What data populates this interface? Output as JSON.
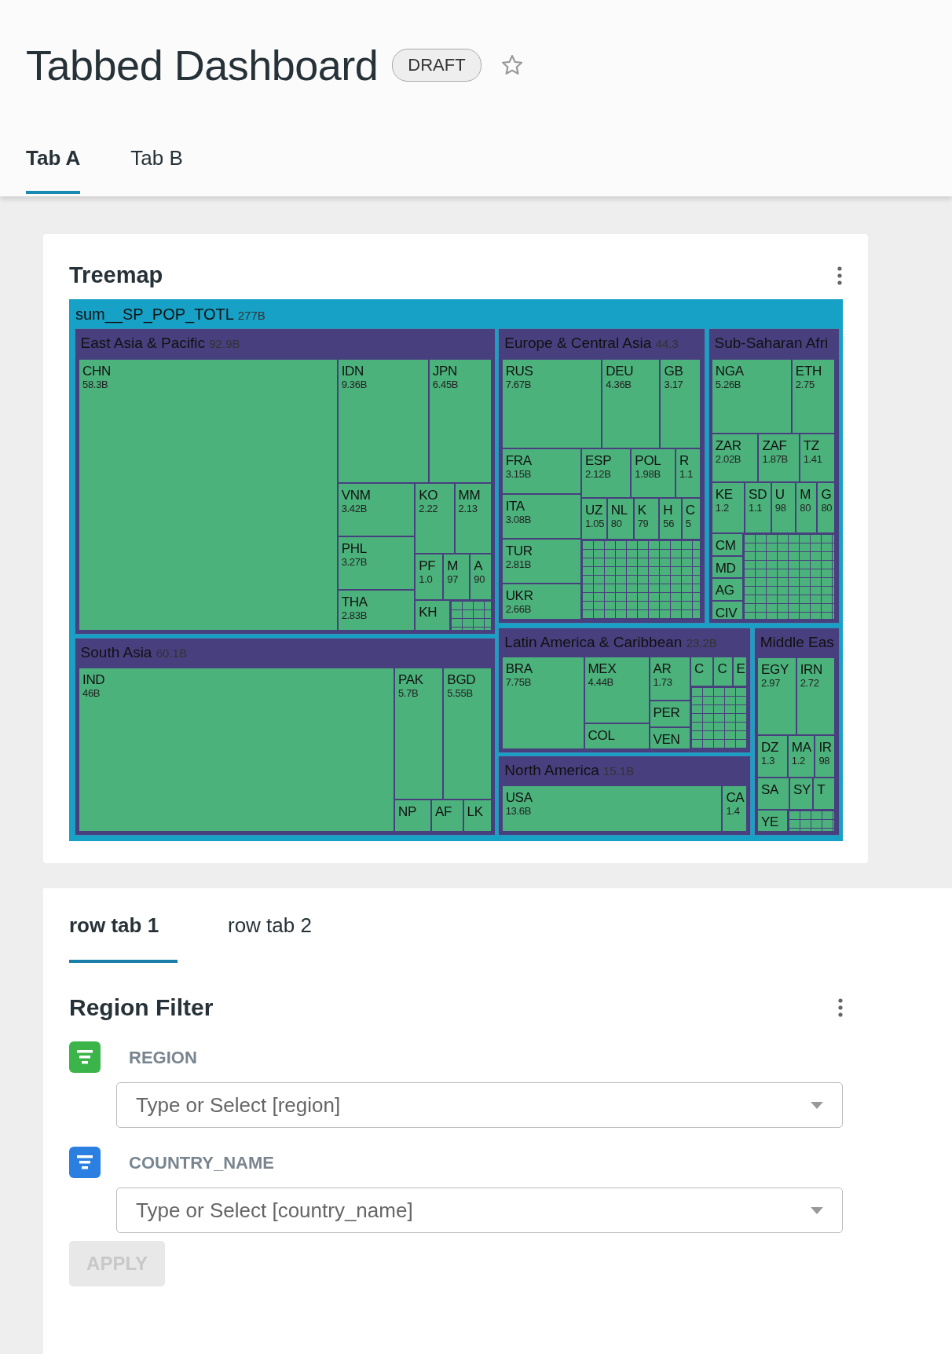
{
  "header": {
    "title": "Tabbed Dashboard",
    "badge": "DRAFT",
    "starred": false
  },
  "tabs": [
    {
      "label": "Tab A",
      "selected": true
    },
    {
      "label": "Tab B",
      "selected": false
    }
  ],
  "treemap_card": {
    "title": "Treemap",
    "root_label": "sum__SP_POP_TOTL",
    "root_value": "277B",
    "regions": [
      {
        "name": "East Asia & Pacific",
        "value": "92.9B",
        "countries": [
          {
            "code": "CHN",
            "value": "58.3B"
          },
          {
            "code": "IDN",
            "value": "9.36B"
          },
          {
            "code": "JPN",
            "value": "6.45B"
          },
          {
            "code": "VNM",
            "value": "3.42B"
          },
          {
            "code": "PHL",
            "value": "3.27B"
          },
          {
            "code": "THA",
            "value": "2.83B"
          },
          {
            "code": "KO",
            "value": "2.22"
          },
          {
            "code": "MM",
            "value": "2.13"
          },
          {
            "code": "PF",
            "value": "1.0"
          },
          {
            "code": "M",
            "value": "97"
          },
          {
            "code": "A",
            "value": "90"
          },
          {
            "code": "KH"
          }
        ]
      },
      {
        "name": "Europe & Central Asia",
        "value": "44.3",
        "countries": [
          {
            "code": "RUS",
            "value": "7.67B"
          },
          {
            "code": "DEU",
            "value": "4.36B"
          },
          {
            "code": "GB",
            "value": "3.17"
          },
          {
            "code": "FRA",
            "value": "3.15B"
          },
          {
            "code": "ITA",
            "value": "3.08B"
          },
          {
            "code": "TUR",
            "value": "2.81B"
          },
          {
            "code": "UKR",
            "value": "2.66B"
          },
          {
            "code": "ESP",
            "value": "2.12B"
          },
          {
            "code": "POL",
            "value": "1.98B"
          },
          {
            "code": "R",
            "value": "1.1"
          },
          {
            "code": "UZ",
            "value": "1.05"
          },
          {
            "code": "NL",
            "value": "80"
          },
          {
            "code": "K",
            "value": "79"
          },
          {
            "code": "H",
            "value": "56"
          },
          {
            "code": "C",
            "value": "5"
          }
        ]
      },
      {
        "name": "Sub-Saharan Afri",
        "countries": [
          {
            "code": "NGA",
            "value": "5.26B"
          },
          {
            "code": "ETH",
            "value": "2.75"
          },
          {
            "code": "ZAR",
            "value": "2.02B"
          },
          {
            "code": "ZAF",
            "value": "1.87B"
          },
          {
            "code": "TZ",
            "value": "1.41"
          },
          {
            "code": "KE",
            "value": "1.2"
          },
          {
            "code": "SD",
            "value": "1.1"
          },
          {
            "code": "U",
            "value": "98"
          },
          {
            "code": "M",
            "value": "80"
          },
          {
            "code": "G",
            "value": "80"
          },
          {
            "code": "CM"
          },
          {
            "code": "MD"
          },
          {
            "code": "AG"
          },
          {
            "code": "CIV"
          }
        ]
      },
      {
        "name": "South Asia",
        "value": "60.1B",
        "countries": [
          {
            "code": "IND",
            "value": "46B"
          },
          {
            "code": "PAK",
            "value": "5.7B"
          },
          {
            "code": "BGD",
            "value": "5.55B"
          },
          {
            "code": "NP"
          },
          {
            "code": "AF"
          },
          {
            "code": "LK"
          }
        ]
      },
      {
        "name": "Latin America & Caribbean",
        "value": "23.2B",
        "countries": [
          {
            "code": "BRA",
            "value": "7.75B"
          },
          {
            "code": "MEX",
            "value": "4.44B"
          },
          {
            "code": "COL"
          },
          {
            "code": "AR",
            "value": "1.73"
          },
          {
            "code": "PER"
          },
          {
            "code": "VEN"
          },
          {
            "code": "C"
          },
          {
            "code": "C"
          },
          {
            "code": "E"
          }
        ]
      },
      {
        "name": "Middle Eas",
        "countries": [
          {
            "code": "EGY",
            "value": "2.97"
          },
          {
            "code": "IRN",
            "value": "2.72"
          },
          {
            "code": "DZ",
            "value": "1.3"
          },
          {
            "code": "MA",
            "value": "1.2"
          },
          {
            "code": "IR",
            "value": "98"
          },
          {
            "code": "SA"
          },
          {
            "code": "SY"
          },
          {
            "code": "T"
          },
          {
            "code": "YE"
          }
        ]
      },
      {
        "name": "North America",
        "value": "15.1B",
        "countries": [
          {
            "code": "USA",
            "value": "13.6B"
          },
          {
            "code": "CA",
            "value": "1.4"
          }
        ]
      }
    ]
  },
  "row_tabs": [
    {
      "label": "row tab 1",
      "selected": true
    },
    {
      "label": "row tab 2",
      "selected": false
    }
  ],
  "filter_card": {
    "title": "Region Filter",
    "filters": [
      {
        "label": "REGION",
        "placeholder": "Type or Select [region]",
        "color": "#3bb44a"
      },
      {
        "label": "COUNTRY_NAME",
        "placeholder": "Type or Select [country_name]",
        "color": "#2a7fe0"
      }
    ],
    "apply": {
      "label": "APPLY",
      "disabled": true
    }
  }
}
